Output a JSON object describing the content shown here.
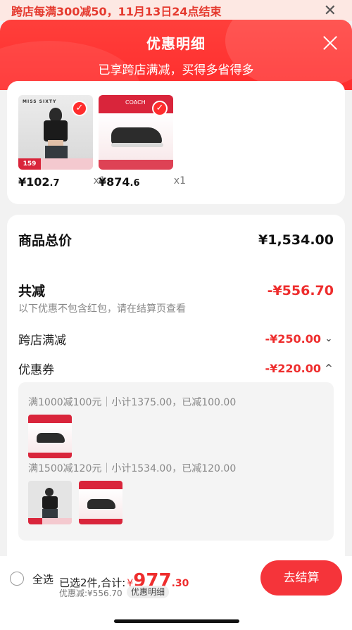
{
  "banner": {
    "text": "跨店每满300减50，11月13日24点结束",
    "close": "✕"
  },
  "header": {
    "title": "优惠明细",
    "subtitle": "已享跨店满减，买得多省得多"
  },
  "products": [
    {
      "thumb_brand": "MISS SIXTY",
      "thumb_price": "159",
      "price": "¥102",
      "price_dec": ".7",
      "qty": "x1"
    },
    {
      "thumb_brand": "COACH",
      "price": "¥874",
      "price_dec": ".6",
      "qty": "x1"
    }
  ],
  "summary": {
    "total_label": "商品总价",
    "total_value": "¥1,534.00",
    "discount_label": "共减",
    "discount_value": "-¥556.70",
    "note": "以下优惠不包含红包，请在结算页查看",
    "cross_label": "跨店满减",
    "cross_value": "-¥250.00",
    "coupon_label": "优惠券",
    "coupon_value": "-¥220.00"
  },
  "coupons": [
    {
      "condition": "满1000减100元｜小计1375.00，已减100.00"
    },
    {
      "condition": "满1500减120元｜小计1534.00，已减120.00"
    }
  ],
  "footer": {
    "select_all": "全选",
    "selected_text": "已选2件,合计:",
    "currency": "¥",
    "total_int": "977",
    "total_dec": ".30",
    "discount_text": "优惠减:¥556.70",
    "detail_pill": "优惠明细",
    "checkout": "去结算"
  },
  "colors": {
    "accent": "#ee2d2d",
    "header": "#ff3f3b"
  }
}
